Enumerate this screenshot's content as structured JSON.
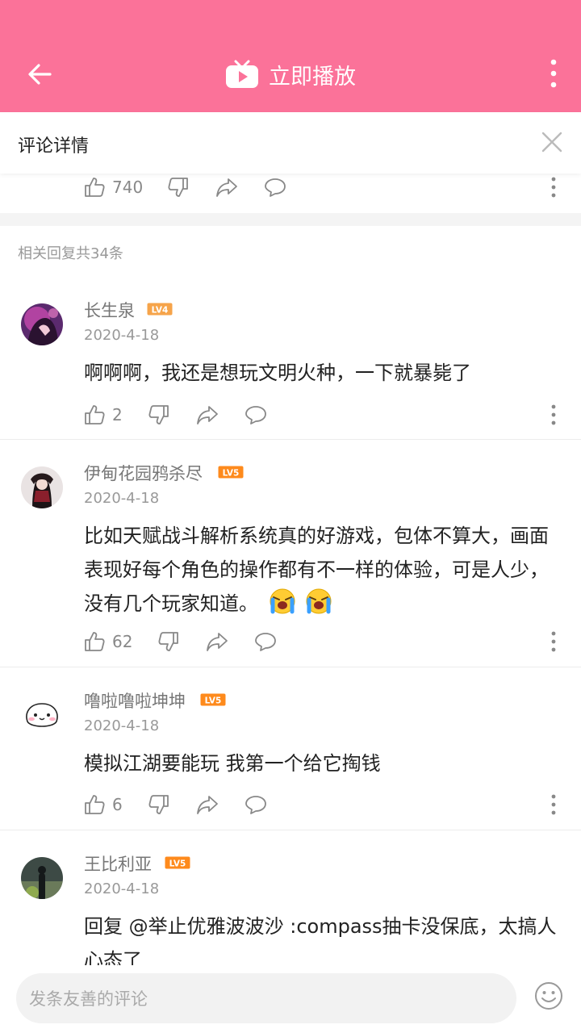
{
  "header": {
    "title": "立即播放"
  },
  "sub_header": {
    "title": "评论详情"
  },
  "main_comment_actions": {
    "likes": "740"
  },
  "replies": {
    "count_label": "相关回复共34条"
  },
  "comments": [
    {
      "username": "长生泉",
      "level": "LV4",
      "date": "2020-4-18",
      "text": "啊啊啊，我还是想玩文明火种，一下就暴毙了",
      "likes": "2"
    },
    {
      "username": "伊甸花园鸦杀尽",
      "level": "LV5",
      "date": "2020-4-18",
      "text": "比如天赋战斗解析系统真的好游戏，包体不算大，画面表现好每个角色的操作都有不一样的体验，可是人少，没有几个玩家知道。",
      "likes": "62"
    },
    {
      "username": "噜啦噜啦坤坤",
      "level": "LV5",
      "date": "2020-4-18",
      "text": "模拟江湖要能玩 我第一个给它掏钱",
      "likes": "6"
    },
    {
      "username": "王比利亚",
      "level": "LV5",
      "date": "2020-4-18",
      "text": "回复 @举止优雅波波沙 :compass抽卡没保底，太搞人心态了"
    }
  ],
  "bottom": {
    "placeholder": "发条友善的评论"
  },
  "colors": {
    "brand_pink": "#fb7299",
    "lv4": "#f6a44a",
    "lv5": "#fe8a1c"
  }
}
